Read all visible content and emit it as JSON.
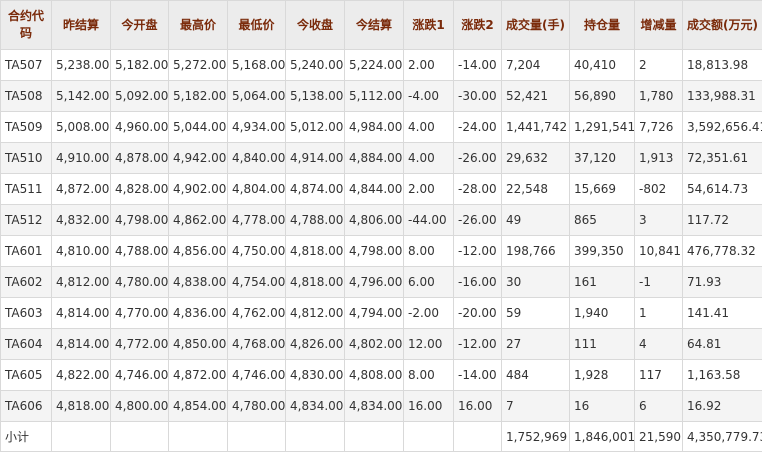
{
  "headers": [
    "合约代码",
    "昨结算",
    "今开盘",
    "最高价",
    "最低价",
    "今收盘",
    "今结算",
    "涨跌1",
    "涨跌2",
    "成交量(手)",
    "持仓量",
    "增减量",
    "成交额(万元)"
  ],
  "rows": [
    [
      "TA507",
      "5,238.00",
      "5,182.00",
      "5,272.00",
      "5,168.00",
      "5,240.00",
      "5,224.00",
      "2.00",
      "-14.00",
      "7,204",
      "40,410",
      "2",
      "18,813.98"
    ],
    [
      "TA508",
      "5,142.00",
      "5,092.00",
      "5,182.00",
      "5,064.00",
      "5,138.00",
      "5,112.00",
      "-4.00",
      "-30.00",
      "52,421",
      "56,890",
      "1,780",
      "133,988.31"
    ],
    [
      "TA509",
      "5,008.00",
      "4,960.00",
      "5,044.00",
      "4,934.00",
      "5,012.00",
      "4,984.00",
      "4.00",
      "-24.00",
      "1,441,742",
      "1,291,541",
      "7,726",
      "3,592,656.41"
    ],
    [
      "TA510",
      "4,910.00",
      "4,878.00",
      "4,942.00",
      "4,840.00",
      "4,914.00",
      "4,884.00",
      "4.00",
      "-26.00",
      "29,632",
      "37,120",
      "1,913",
      "72,351.61"
    ],
    [
      "TA511",
      "4,872.00",
      "4,828.00",
      "4,902.00",
      "4,804.00",
      "4,874.00",
      "4,844.00",
      "2.00",
      "-28.00",
      "22,548",
      "15,669",
      "-802",
      "54,614.73"
    ],
    [
      "TA512",
      "4,832.00",
      "4,798.00",
      "4,862.00",
      "4,778.00",
      "4,788.00",
      "4,806.00",
      "-44.00",
      "-26.00",
      "49",
      "865",
      "3",
      "117.72"
    ],
    [
      "TA601",
      "4,810.00",
      "4,788.00",
      "4,856.00",
      "4,750.00",
      "4,818.00",
      "4,798.00",
      "8.00",
      "-12.00",
      "198,766",
      "399,350",
      "10,841",
      "476,778.32"
    ],
    [
      "TA602",
      "4,812.00",
      "4,780.00",
      "4,838.00",
      "4,754.00",
      "4,818.00",
      "4,796.00",
      "6.00",
      "-16.00",
      "30",
      "161",
      "-1",
      "71.93"
    ],
    [
      "TA603",
      "4,814.00",
      "4,770.00",
      "4,836.00",
      "4,762.00",
      "4,812.00",
      "4,794.00",
      "-2.00",
      "-20.00",
      "59",
      "1,940",
      "1",
      "141.41"
    ],
    [
      "TA604",
      "4,814.00",
      "4,772.00",
      "4,850.00",
      "4,768.00",
      "4,826.00",
      "4,802.00",
      "12.00",
      "-12.00",
      "27",
      "111",
      "4",
      "64.81"
    ],
    [
      "TA605",
      "4,822.00",
      "4,746.00",
      "4,872.00",
      "4,746.00",
      "4,830.00",
      "4,808.00",
      "8.00",
      "-14.00",
      "484",
      "1,928",
      "117",
      "1,163.58"
    ],
    [
      "TA606",
      "4,818.00",
      "4,800.00",
      "4,854.00",
      "4,780.00",
      "4,834.00",
      "4,834.00",
      "16.00",
      "16.00",
      "7",
      "16",
      "6",
      "16.92"
    ]
  ],
  "subtotal": [
    "小计",
    "",
    "",
    "",
    "",
    "",
    "",
    "",
    "",
    "1,752,969",
    "1,846,001",
    "21,590",
    "4,350,779.73"
  ]
}
